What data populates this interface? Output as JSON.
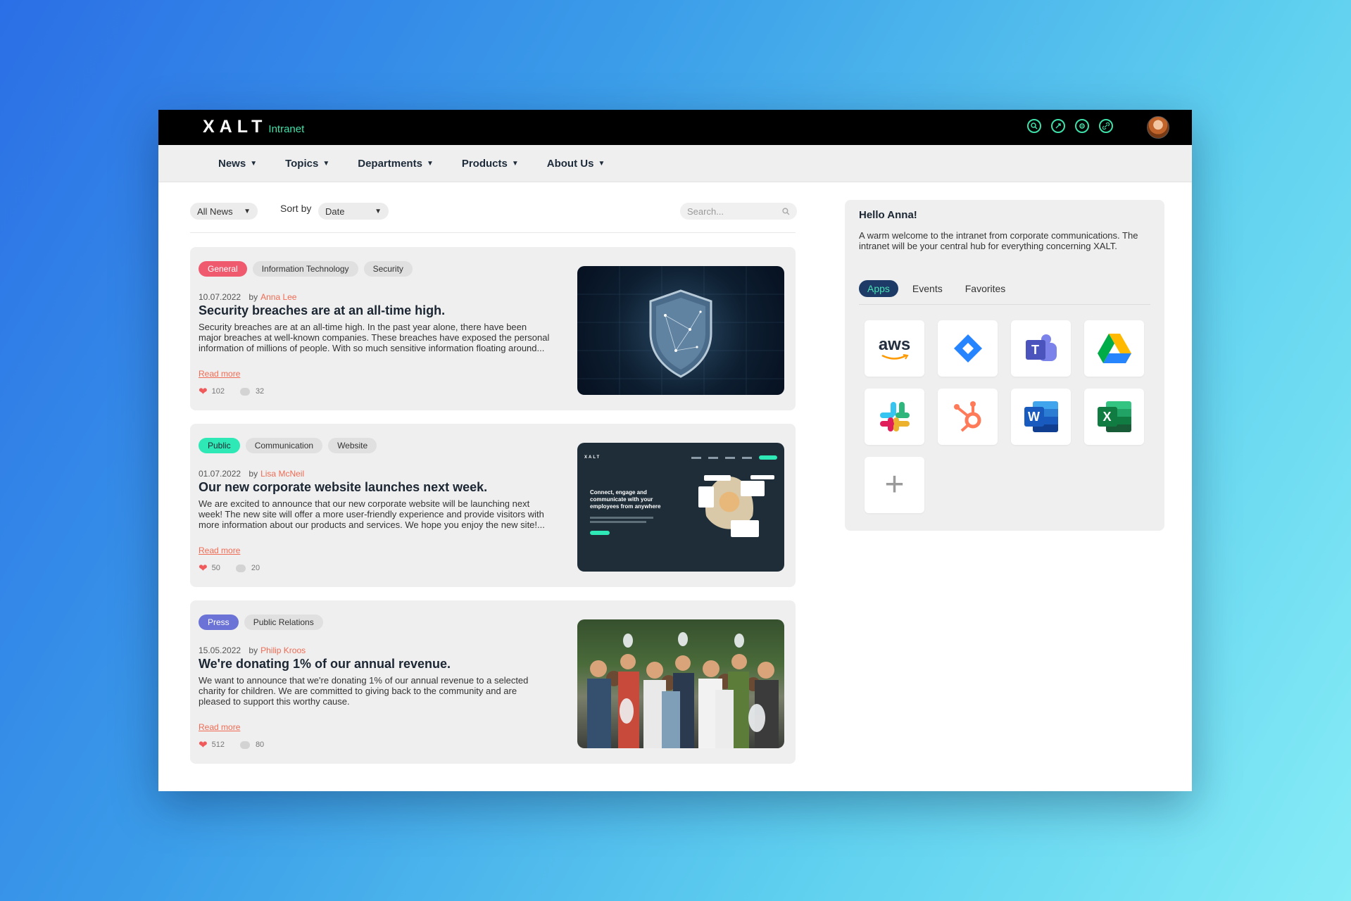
{
  "app": {
    "logo_main": "XALT",
    "logo_sub": "Intranet"
  },
  "topbar": {
    "icons": [
      "search-icon",
      "rocket-icon",
      "gear-icon",
      "link-icon"
    ]
  },
  "menu": [
    {
      "label": "News"
    },
    {
      "label": "Topics"
    },
    {
      "label": "Departments"
    },
    {
      "label": "Products"
    },
    {
      "label": "About Us"
    }
  ],
  "filters": {
    "category": "All News",
    "sort_label": "Sort by",
    "sort_value": "Date",
    "search_placeholder": "Search..."
  },
  "articles": [
    {
      "tags": [
        {
          "label": "General"
        },
        {
          "label": "Information Technology"
        },
        {
          "label": "Security"
        }
      ],
      "date": "10.07.2022",
      "by": "by",
      "author": "Anna Lee",
      "title": "Security breaches are at an all-time high.",
      "body": "Security breaches are at an all-time high. In the past year alone, there have been major breaches at well-known companies. These breaches have exposed the personal information of millions of people. With so much sensitive information floating around...",
      "read_more": "Read more",
      "likes": "102",
      "comments": "32"
    },
    {
      "tags": [
        {
          "label": "Public"
        },
        {
          "label": "Communication"
        },
        {
          "label": "Website"
        }
      ],
      "date": "01.07.2022",
      "by": "by",
      "author": "Lisa McNeil",
      "title": "Our new corporate website launches next week.",
      "body": "We are excited to announce that our new corporate website will be launching next week! The new site will offer a more user-friendly experience and provide visitors with more information about our products and services. We hope you enjoy the new site!...",
      "read_more": "Read more",
      "likes": "50",
      "comments": "20",
      "thumb_text": "Connect, engage and communicate with your employees from anywhere"
    },
    {
      "tags": [
        {
          "label": "Press"
        },
        {
          "label": "Public Relations"
        }
      ],
      "date": "15.05.2022",
      "by": "by",
      "author": "Philip Kroos",
      "title": "We're donating 1% of our annual revenue.",
      "body": "We want to announce that we're donating 1% of our annual revenue to a selected charity for children. We are committed to giving back to the community and are pleased to support this worthy cause.",
      "read_more": "Read more",
      "likes": "512",
      "comments": "80"
    }
  ],
  "colors": {
    "general": "#f05a6e",
    "public": "#2ee8b6",
    "press": "#6b73d6",
    "accent": "#f06b53",
    "brand_green": "#3ee0a8"
  },
  "panel": {
    "greeting": "Hello Anna!",
    "welcome": "A warm welcome to the intranet from corporate communications. The intranet will be your central hub for everything concerning XALT.",
    "tabs": [
      {
        "label": "Apps"
      },
      {
        "label": "Events"
      },
      {
        "label": "Favorites"
      }
    ],
    "apps": [
      {
        "name": "aws",
        "label": "aws"
      },
      {
        "name": "jira"
      },
      {
        "name": "teams",
        "label": "T"
      },
      {
        "name": "google-drive"
      },
      {
        "name": "slack"
      },
      {
        "name": "hubspot"
      },
      {
        "name": "word",
        "label": "W"
      },
      {
        "name": "excel",
        "label": "X"
      },
      {
        "name": "add",
        "label": "+"
      }
    ]
  }
}
